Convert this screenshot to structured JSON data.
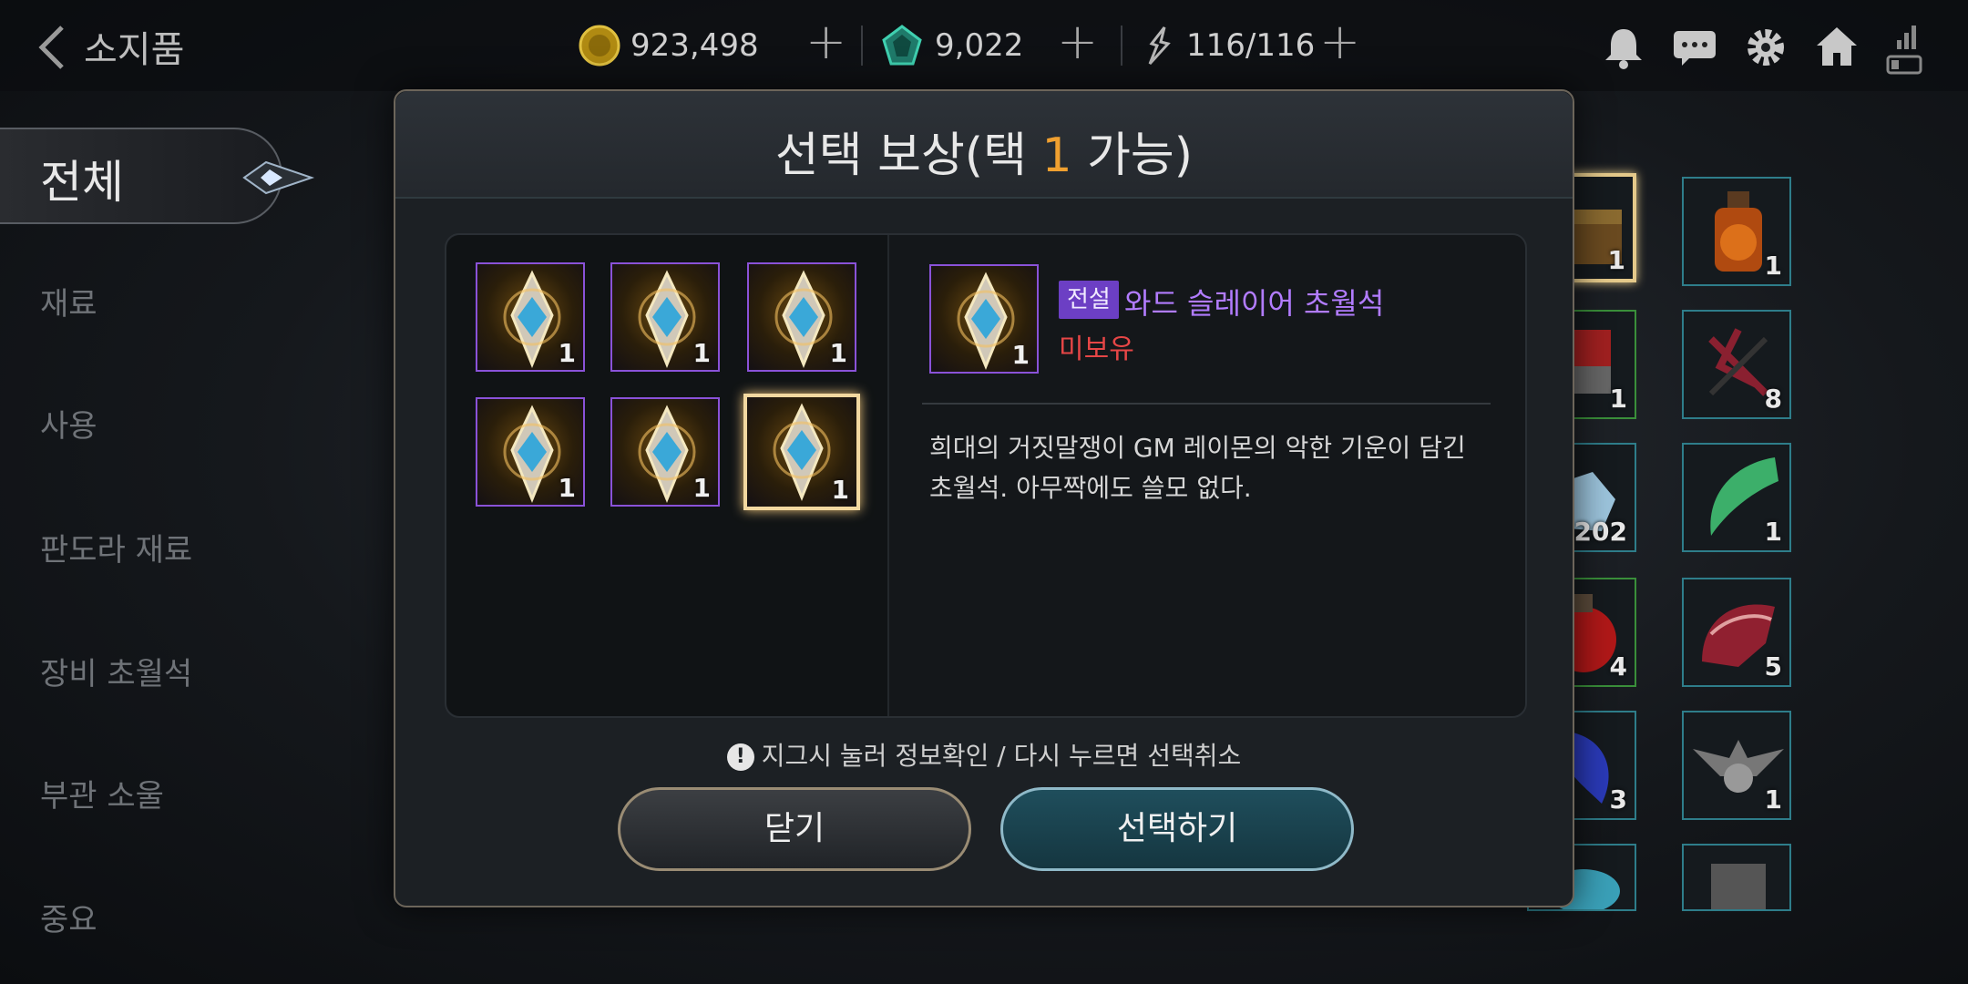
{
  "header": {
    "title": "소지품",
    "gold": "923,498",
    "gems": "9,022",
    "stamina": "116/116",
    "back_icon": "back-arrow-icon"
  },
  "top_icons": [
    "bell-icon",
    "chat-icon",
    "gear-icon",
    "home-icon",
    "signal-battery-icon"
  ],
  "categories": {
    "active": "전체",
    "items": [
      "재료",
      "사용",
      "판도라 재료",
      "장비 초월석",
      "부관 소울",
      "중요"
    ]
  },
  "inventory": {
    "quantities": [
      "1",
      "1",
      "1",
      "8",
      "202",
      "1",
      "4",
      "5",
      "3",
      "1"
    ]
  },
  "modal": {
    "title_prefix": "선택 보상(택 ",
    "title_count": "1",
    "title_suffix": " 가능)",
    "rewards": [
      {
        "qty": "1"
      },
      {
        "qty": "1"
      },
      {
        "qty": "1"
      },
      {
        "qty": "1"
      },
      {
        "qty": "1"
      },
      {
        "qty": "1"
      }
    ],
    "detail": {
      "qty": "1",
      "grade": "전설",
      "name": "와드 슬레이어 초월석",
      "ownership": "미보유",
      "description_line1": "희대의 거짓말쟁이 GM 레이몬의 악한 기운이 담긴",
      "description_line2": "초월석. 아무짝에도 쓸모 없다."
    },
    "hint": "지그시 눌러 정보확인 / 다시 누르면 선택취소",
    "hint_icon": "!",
    "close_label": "닫기",
    "select_label": "선택하기"
  },
  "colors": {
    "accent": "#f0a030",
    "legendary": "#b27cff",
    "not_owned": "#e64646",
    "badge": "#6c3fc4"
  }
}
